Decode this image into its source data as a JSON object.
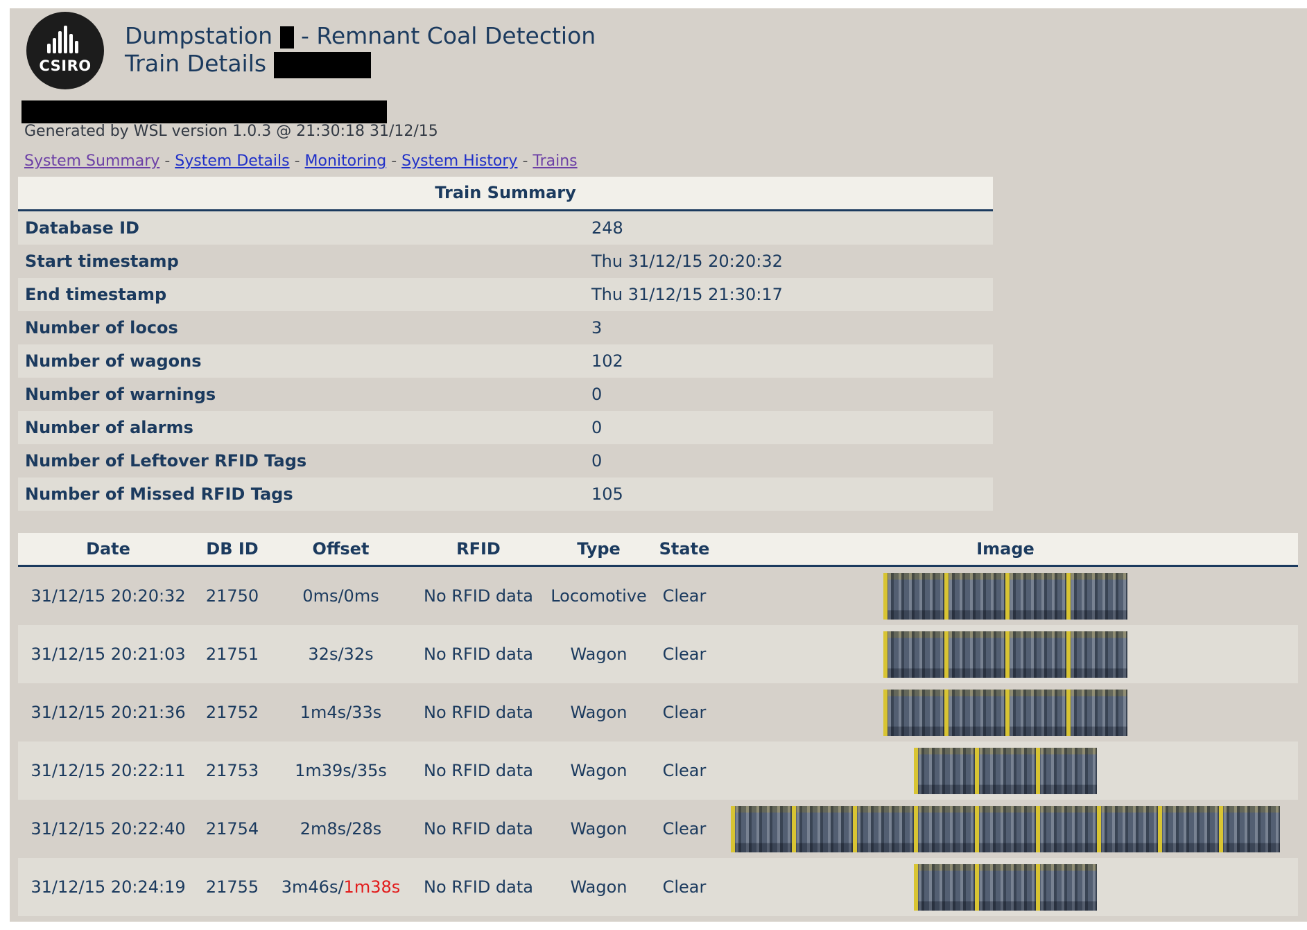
{
  "header": {
    "logo_text": "CSIRO",
    "title_prefix": "Dumpstation",
    "title_suffix": "- Remnant Coal Detection",
    "subtitle": "Train Details"
  },
  "generated": "Generated by WSL version 1.0.3 @ 21:30:18 31/12/15",
  "nav": [
    {
      "label": "System Summary",
      "visited": true
    },
    {
      "label": "System Details",
      "visited": false
    },
    {
      "label": "Monitoring",
      "visited": false
    },
    {
      "label": "System History",
      "visited": false
    },
    {
      "label": "Trains",
      "visited": true
    }
  ],
  "nav_separator": "-",
  "summary": {
    "title": "Train Summary",
    "rows": [
      {
        "label": "Database ID",
        "value": "248"
      },
      {
        "label": "Start timestamp",
        "value": "Thu 31/12/15 20:20:32"
      },
      {
        "label": "End timestamp",
        "value": "Thu 31/12/15 21:30:17"
      },
      {
        "label": "Number of locos",
        "value": "3"
      },
      {
        "label": "Number of wagons",
        "value": "102"
      },
      {
        "label": "Number of warnings",
        "value": "0"
      },
      {
        "label": "Number of alarms",
        "value": "0"
      },
      {
        "label": "Number of Leftover RFID Tags",
        "value": "0"
      },
      {
        "label": "Number of Missed RFID Tags",
        "value": "105"
      }
    ]
  },
  "wagons": {
    "columns": [
      "Date",
      "DB ID",
      "Offset",
      "RFID",
      "Type",
      "State",
      "Image"
    ],
    "rows": [
      {
        "date": "31/12/15 20:20:32",
        "dbid": "21750",
        "offset_total": "0ms",
        "offset_delta": "0ms",
        "delta_late": false,
        "rfid": "No RFID data",
        "type": "Locomotive",
        "state": "Clear",
        "image_tiles": 4
      },
      {
        "date": "31/12/15 20:21:03",
        "dbid": "21751",
        "offset_total": "32s",
        "offset_delta": "32s",
        "delta_late": false,
        "rfid": "No RFID data",
        "type": "Wagon",
        "state": "Clear",
        "image_tiles": 4
      },
      {
        "date": "31/12/15 20:21:36",
        "dbid": "21752",
        "offset_total": "1m4s",
        "offset_delta": "33s",
        "delta_late": false,
        "rfid": "No RFID data",
        "type": "Wagon",
        "state": "Clear",
        "image_tiles": 4
      },
      {
        "date": "31/12/15 20:22:11",
        "dbid": "21753",
        "offset_total": "1m39s",
        "offset_delta": "35s",
        "delta_late": false,
        "rfid": "No RFID data",
        "type": "Wagon",
        "state": "Clear",
        "image_tiles": 3
      },
      {
        "date": "31/12/15 20:22:40",
        "dbid": "21754",
        "offset_total": "2m8s",
        "offset_delta": "28s",
        "delta_late": false,
        "rfid": "No RFID data",
        "type": "Wagon",
        "state": "Clear",
        "image_tiles": 9
      },
      {
        "date": "31/12/15 20:24:19",
        "dbid": "21755",
        "offset_total": "3m46s",
        "offset_delta": "1m38s",
        "delta_late": true,
        "rfid": "No RFID data",
        "type": "Wagon",
        "state": "Clear",
        "image_tiles": 3
      }
    ]
  },
  "colors": {
    "text": "#1b3a5e",
    "late": "#e21b1b",
    "visited": "#6c3fa6",
    "link": "#1f2fc8"
  }
}
